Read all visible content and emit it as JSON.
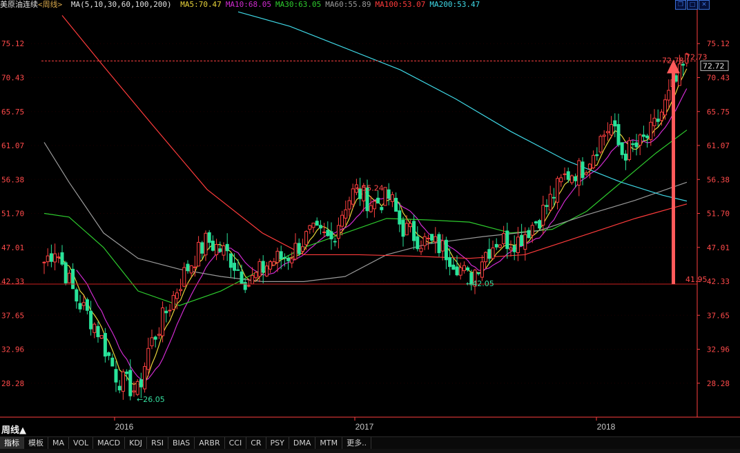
{
  "window": {
    "title": "美原油连续",
    "period_tag": "<周线>"
  },
  "ma_header": {
    "config": "MA(5,10,30,60,100,200)",
    "items": [
      {
        "label": "MA5:70.47",
        "color": "#e8d33a"
      },
      {
        "label": "MA10:68.05",
        "color": "#d02bd0"
      },
      {
        "label": "MA30:63.05",
        "color": "#2ecc2e"
      },
      {
        "label": "MA60:55.89",
        "color": "#9a9a9a"
      },
      {
        "label": "MA100:53.07",
        "color": "#ff3b3b"
      },
      {
        "label": "MA200:53.47",
        "color": "#3fd8e6"
      }
    ]
  },
  "colors": {
    "up": "#ff4040",
    "down": "#29e39a",
    "axis": "#ff4040",
    "grid": "#3a0000",
    "label_red": "#ff4a4a",
    "label_green": "#35e0a0"
  },
  "icons": [
    "restore-icon",
    "fullscreen-icon",
    "close-icon"
  ],
  "period_label": "周线▲",
  "toolbar": {
    "items": [
      "指标",
      "模板",
      "MA",
      "VOL",
      "MACD",
      "KDJ",
      "RSI",
      "BIAS",
      "ARBR",
      "CCI",
      "CR",
      "PSY",
      "DMA",
      "MTM",
      "更多.."
    ],
    "selected": 0
  },
  "chart_data": {
    "type": "candlestick",
    "y_ticks": [
      "75.12",
      "70.43",
      "65.75",
      "61.07",
      "56.38",
      "51.70",
      "47.01",
      "42.33",
      "37.65",
      "32.96",
      "28.28"
    ],
    "ylim": [
      23.6,
      79.8
    ],
    "x_labels": [
      "2016",
      "2017",
      "2018"
    ],
    "annotations": {
      "high_2017": "55.24",
      "low_2016": "26.05",
      "low_2017": "42.05",
      "peak": "72.73",
      "peak_alt": "72.78",
      "support": "41.95",
      "current": "72.72"
    },
    "reference_lines": {
      "high": 72.73,
      "low": 41.95
    }
  }
}
